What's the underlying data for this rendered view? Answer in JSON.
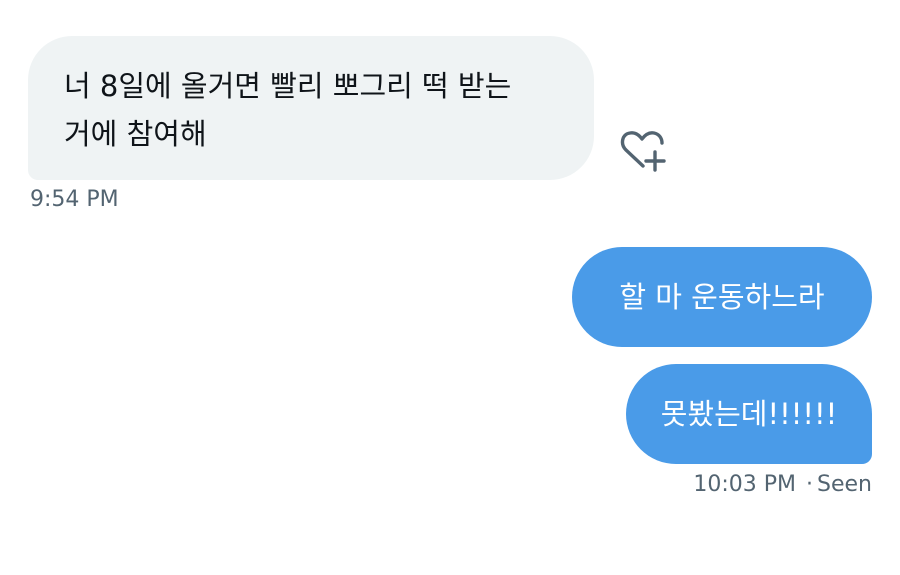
{
  "incoming": {
    "message": "너 8일에 올거면 빨리 뽀그리 떡 받는 거에 참여해",
    "time": "9:54 PM",
    "react_icon": "heart-plus-icon"
  },
  "outgoing": {
    "messages": [
      "할 마 운동하느라",
      "못봤는데!!!!!!"
    ],
    "time": "10:03 PM",
    "separator": "·",
    "status": "Seen"
  },
  "colors": {
    "incoming_bubble": "#eff3f4",
    "outgoing_bubble": "#4a9be8",
    "meta_text": "#536471"
  }
}
